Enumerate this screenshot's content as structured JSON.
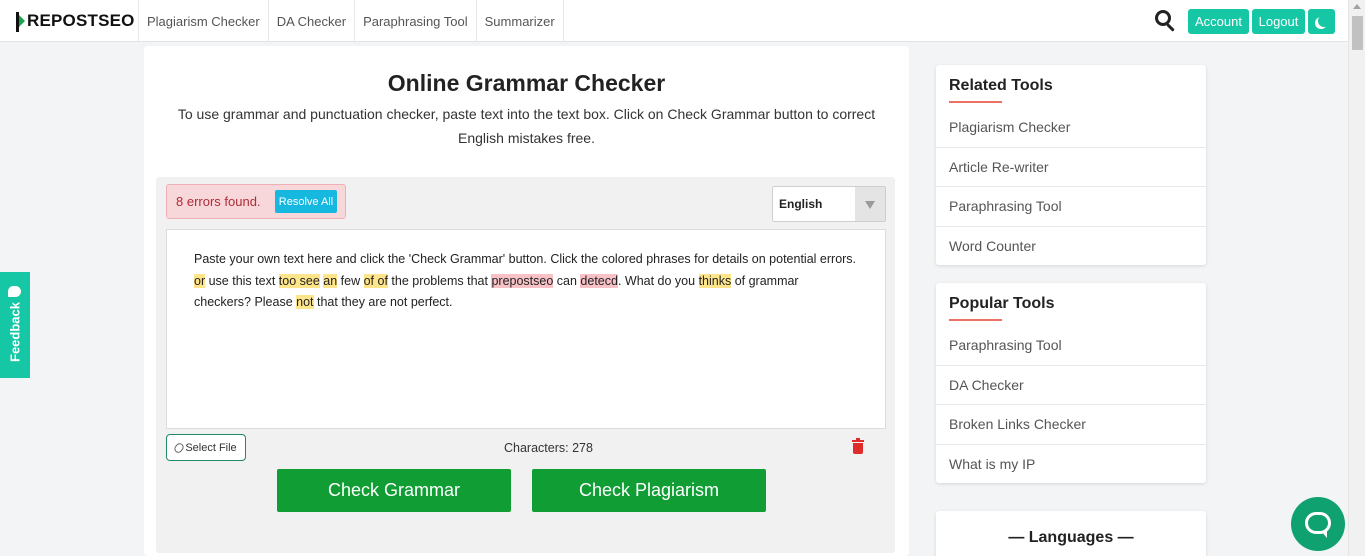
{
  "header": {
    "logo_text": "REPOSTSEO",
    "nav": [
      "Plagiarism Checker",
      "DA Checker",
      "Paraphrasing Tool",
      "Summarizer"
    ],
    "account_label": "Account",
    "logout_label": "Logout"
  },
  "feedback_label": "Feedback",
  "main": {
    "title": "Online Grammar Checker",
    "subtitle": "To use grammar and punctuation checker, paste text into the text box. Click on Check Grammar button to correct English mistakes free.",
    "errors_text": "8 errors found.",
    "resolve_label": "Resolve All",
    "language": "English",
    "editor_segments": [
      {
        "text": "Paste your own text here and click the 'Check Grammar' button. Click the colored phrases for details on potential errors. ",
        "hl": ""
      },
      {
        "text": "or",
        "hl": "y"
      },
      {
        "text": " use this text ",
        "hl": ""
      },
      {
        "text": "too see",
        "hl": "y"
      },
      {
        "text": " ",
        "hl": ""
      },
      {
        "text": "an",
        "hl": "y"
      },
      {
        "text": " few ",
        "hl": ""
      },
      {
        "text": "of of",
        "hl": "y"
      },
      {
        "text": " the problems that ",
        "hl": ""
      },
      {
        "text": "prepostseo",
        "hl": "r"
      },
      {
        "text": " can ",
        "hl": ""
      },
      {
        "text": "detecd",
        "hl": "r"
      },
      {
        "text": ". What do you ",
        "hl": ""
      },
      {
        "text": "thinks",
        "hl": "y"
      },
      {
        "text": " of grammar checkers? Please ",
        "hl": ""
      },
      {
        "text": "not",
        "hl": "y"
      },
      {
        "text": " that they are not perfect.",
        "hl": ""
      }
    ],
    "select_file_label": "Select File",
    "characters_label": "Characters: 278",
    "check_grammar_label": "Check Grammar",
    "check_plagiarism_label": "Check Plagiarism"
  },
  "sidebar": {
    "related_title": "Related Tools",
    "related_items": [
      "Plagiarism Checker",
      "Article Re-writer",
      "Paraphrasing Tool",
      "Word Counter"
    ],
    "popular_title": "Popular Tools",
    "popular_items": [
      "Paraphrasing Tool",
      "DA Checker",
      "Broken Links Checker",
      "What is my IP"
    ],
    "languages_title": "— Languages —"
  },
  "colors": {
    "accent": "#16c7a5",
    "primary_button": "#0f9d34",
    "error_highlight": "#f7c1c6",
    "warning_highlight": "#ffe58a"
  }
}
